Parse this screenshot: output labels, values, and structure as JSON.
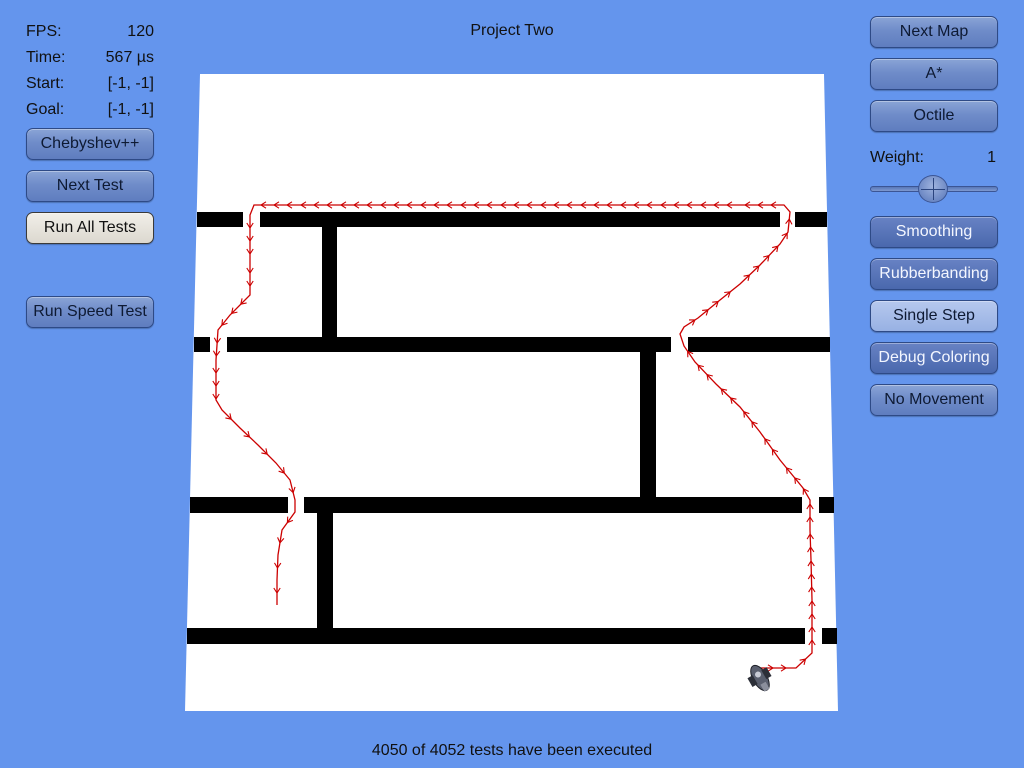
{
  "title": "Project Two",
  "status": "4050 of 4052 tests have been executed",
  "stats": {
    "fps_label": "FPS:",
    "fps_value": "120",
    "time_label": "Time:",
    "time_value": "567 µs",
    "start_label": "Start:",
    "start_value": "[-1, -1]",
    "goal_label": "Goal:",
    "goal_value": "[-1, -1]"
  },
  "left_buttons": {
    "heuristic": "Chebyshev++",
    "next_test": "Next Test",
    "run_all": "Run All Tests",
    "speed_test": "Run Speed Test"
  },
  "right_buttons": {
    "next_map": "Next Map",
    "algorithm": "A*",
    "heuristic": "Octile",
    "smoothing": "Smoothing",
    "rubberbanding": "Rubberbanding",
    "single_step": "Single Step",
    "debug_coloring": "Debug Coloring",
    "no_movement": "No Movement"
  },
  "weight": {
    "label": "Weight:",
    "value": "1",
    "slider_fraction": 0.5
  },
  "colors": {
    "background": "#6495ED",
    "map_floor": "#FFFFFF",
    "walls": "#000000",
    "path": "#CC0000"
  },
  "icons": {
    "agent": "robot-agent-icon"
  }
}
